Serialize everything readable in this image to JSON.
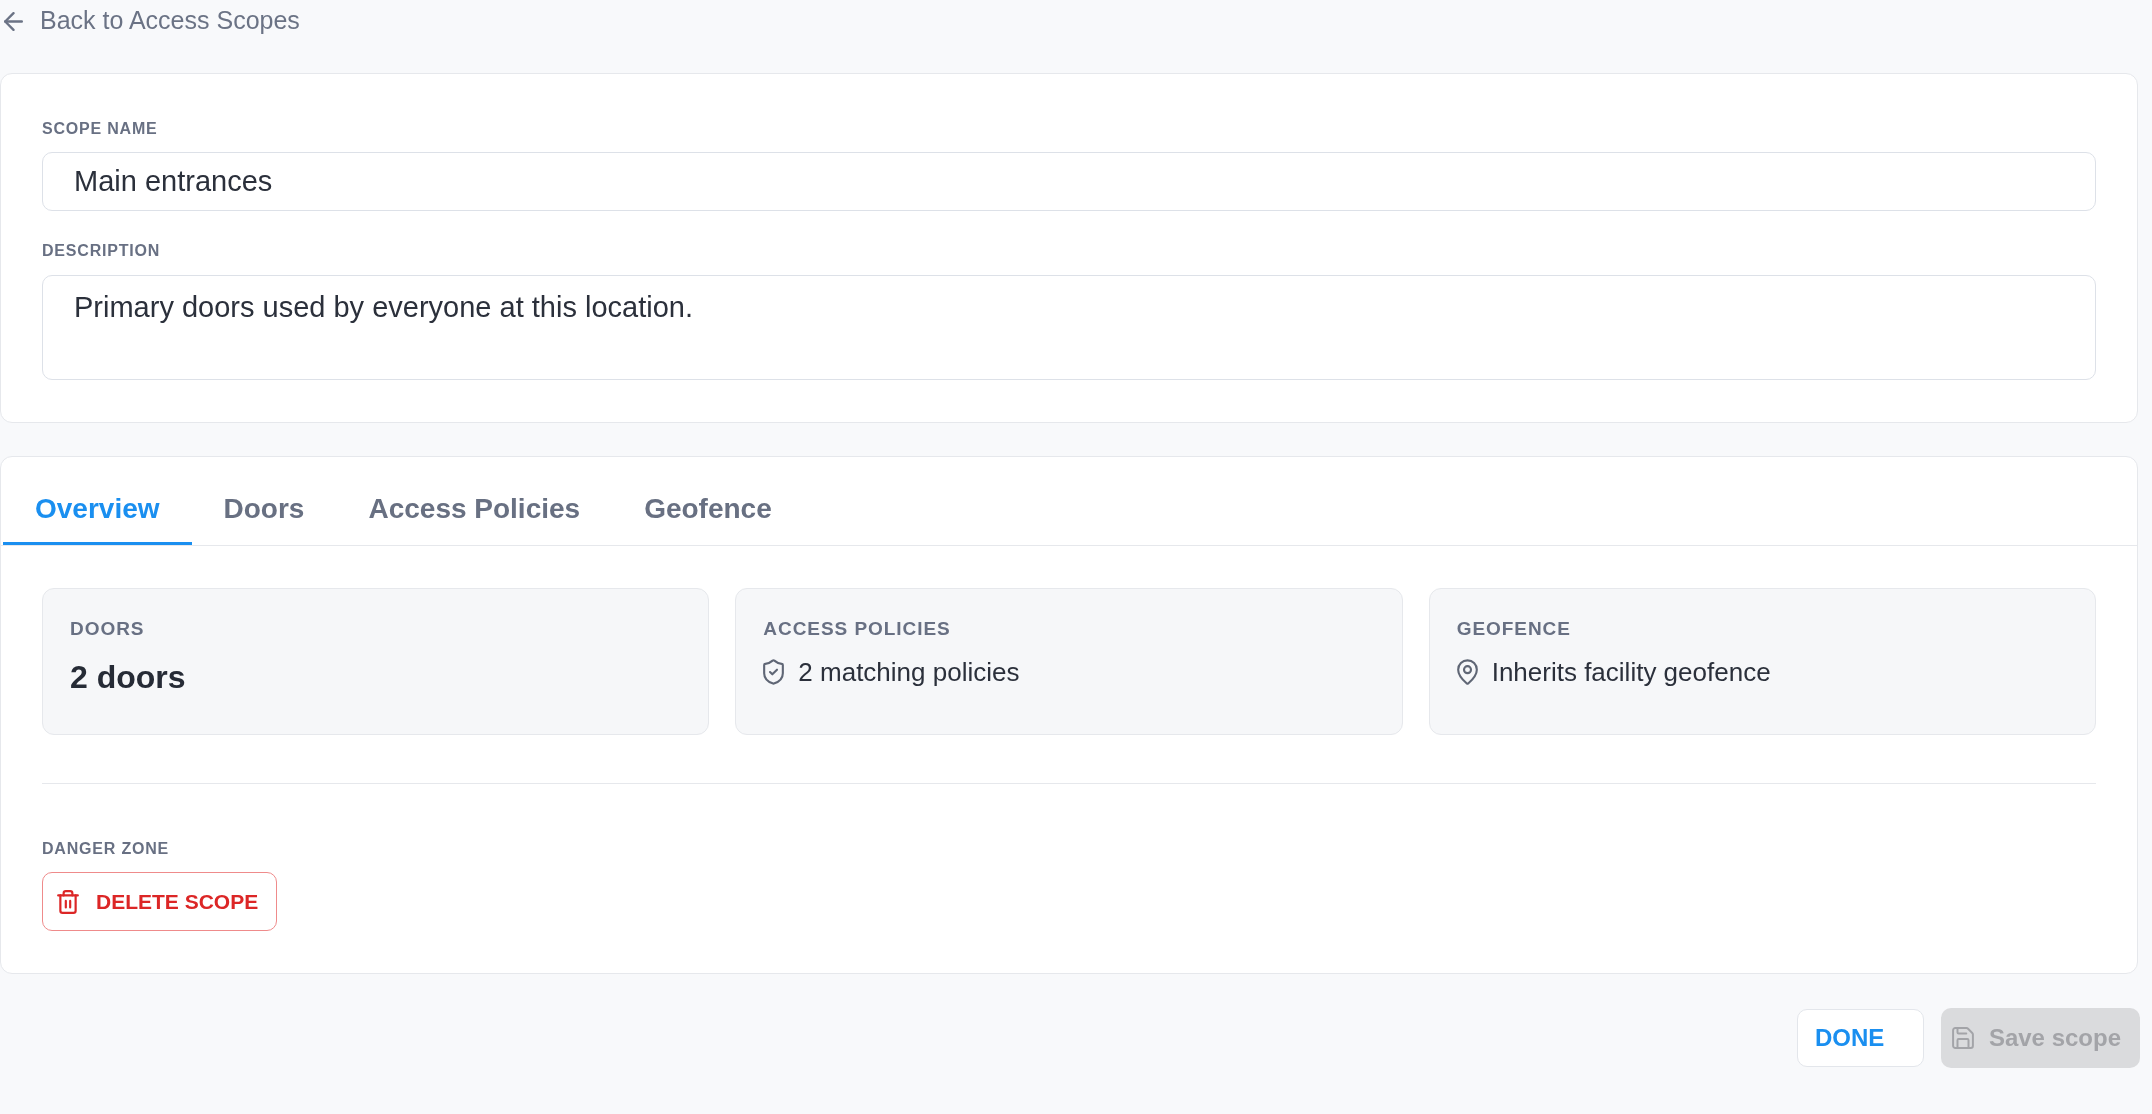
{
  "back_link": {
    "label": "Back to Access Scopes"
  },
  "details_card": {
    "fields": [
      {
        "kind": "input",
        "label": "SCOPE NAME",
        "value": "Main entrances"
      },
      {
        "kind": "textarea",
        "label": "DESCRIPTION",
        "value": "Primary doors used by everyone at this location."
      }
    ]
  },
  "tabs": [
    {
      "label": "Overview",
      "selected": true
    },
    {
      "label": "Doors",
      "selected": false
    },
    {
      "label": "Access Policies",
      "selected": false
    },
    {
      "label": "Geofence",
      "selected": false
    }
  ],
  "overview": {
    "stats": [
      {
        "kind": "count",
        "label": "DOORS",
        "value": "2 doors"
      },
      {
        "kind": "policies",
        "label": "ACCESS POLICIES",
        "value": "2 matching policies"
      },
      {
        "kind": "geofence",
        "label": "GEOFENCE",
        "value": "Inherits facility geofence"
      }
    ],
    "danger_zone": {
      "label": "DANGER ZONE",
      "button": "DELETE SCOPE"
    }
  },
  "footer_buttons": [
    {
      "kind": "done",
      "label": "DONE",
      "disabled": false
    },
    {
      "kind": "save",
      "label": "Save scope",
      "disabled": true
    }
  ]
}
